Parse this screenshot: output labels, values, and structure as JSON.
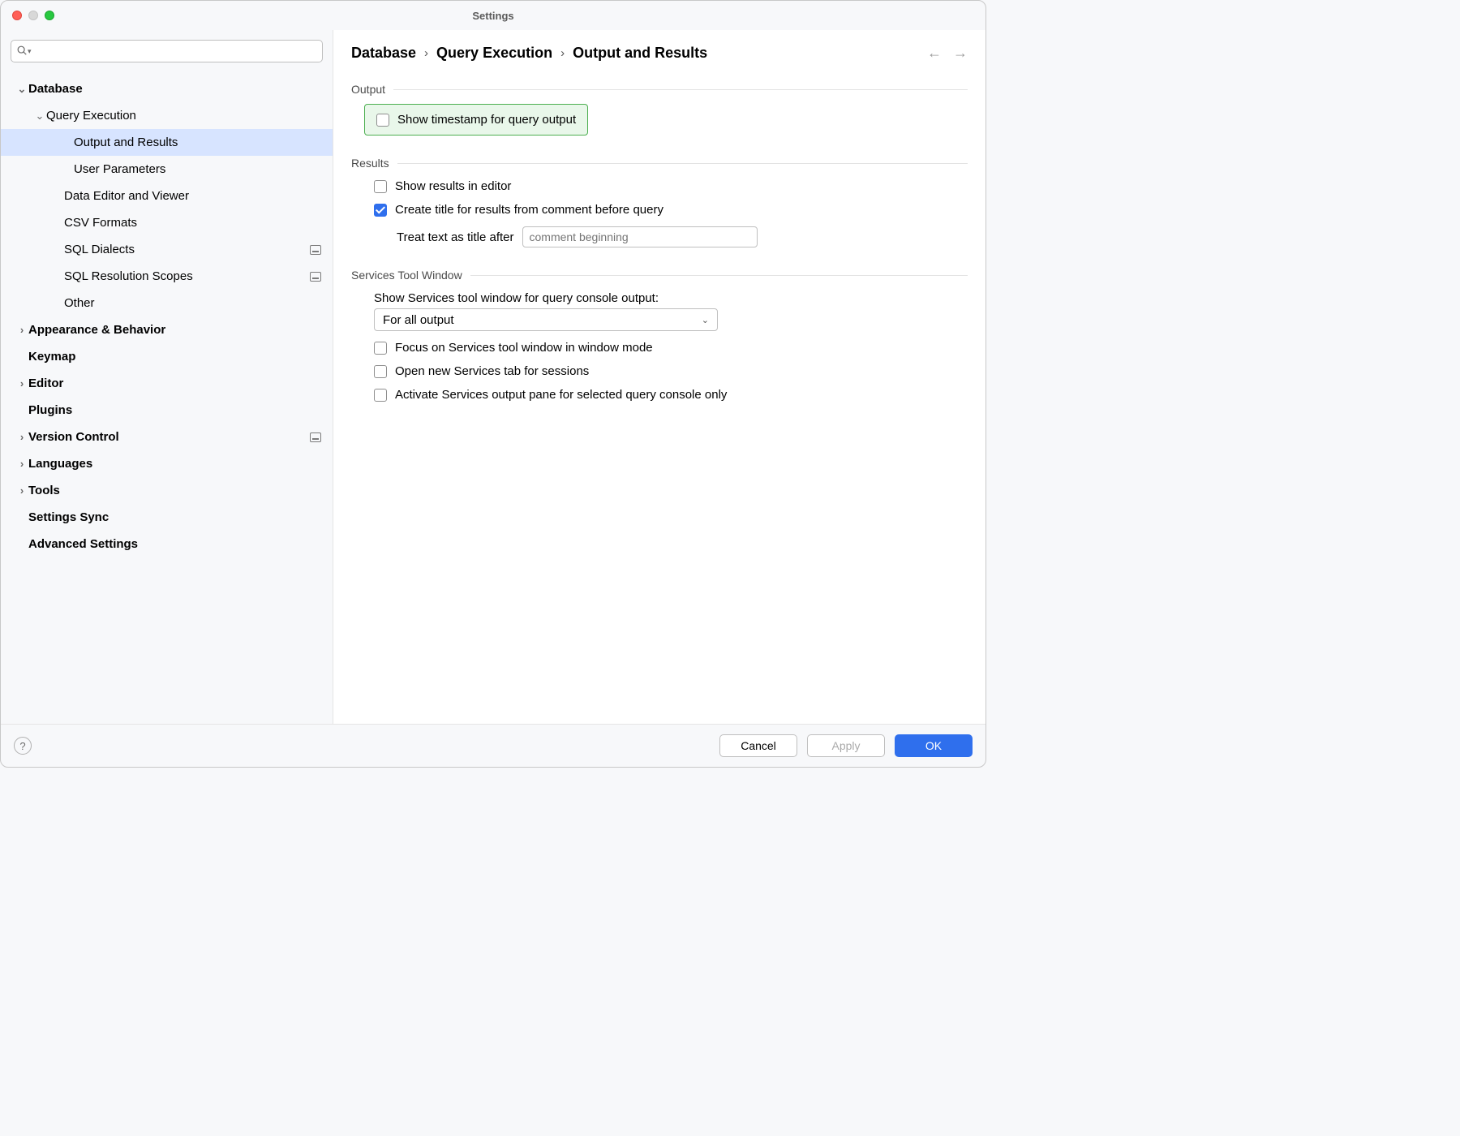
{
  "window": {
    "title": "Settings"
  },
  "search": {
    "placeholder": ""
  },
  "tree": {
    "database": "Database",
    "query_execution": "Query Execution",
    "output_and_results": "Output and Results",
    "user_parameters": "User Parameters",
    "data_editor_and_viewer": "Data Editor and Viewer",
    "csv_formats": "CSV Formats",
    "sql_dialects": "SQL Dialects",
    "sql_resolution_scopes": "SQL Resolution Scopes",
    "other": "Other",
    "appearance_behavior": "Appearance & Behavior",
    "keymap": "Keymap",
    "editor": "Editor",
    "plugins": "Plugins",
    "version_control": "Version Control",
    "languages": "Languages",
    "tools": "Tools",
    "settings_sync": "Settings Sync",
    "advanced_settings": "Advanced Settings"
  },
  "breadcrumb": {
    "seg0": "Database",
    "seg1": "Query Execution",
    "seg2": "Output and Results",
    "sep": "›"
  },
  "sections": {
    "output": {
      "title": "Output",
      "show_timestamp": "Show timestamp for query output"
    },
    "results": {
      "title": "Results",
      "show_in_editor": "Show results in editor",
      "create_title": "Create title for results from comment before query",
      "treat_text_label": "Treat text as title after",
      "treat_text_placeholder": "comment beginning"
    },
    "services": {
      "title": "Services Tool Window",
      "show_services_label": "Show Services tool window for query console output:",
      "show_services_value": "For all output",
      "focus_window": "Focus on Services tool window in window mode",
      "open_new_tab": "Open new Services tab for sessions",
      "activate_pane": "Activate Services output pane for selected query console only"
    }
  },
  "footer": {
    "cancel": "Cancel",
    "apply": "Apply",
    "ok": "OK"
  }
}
